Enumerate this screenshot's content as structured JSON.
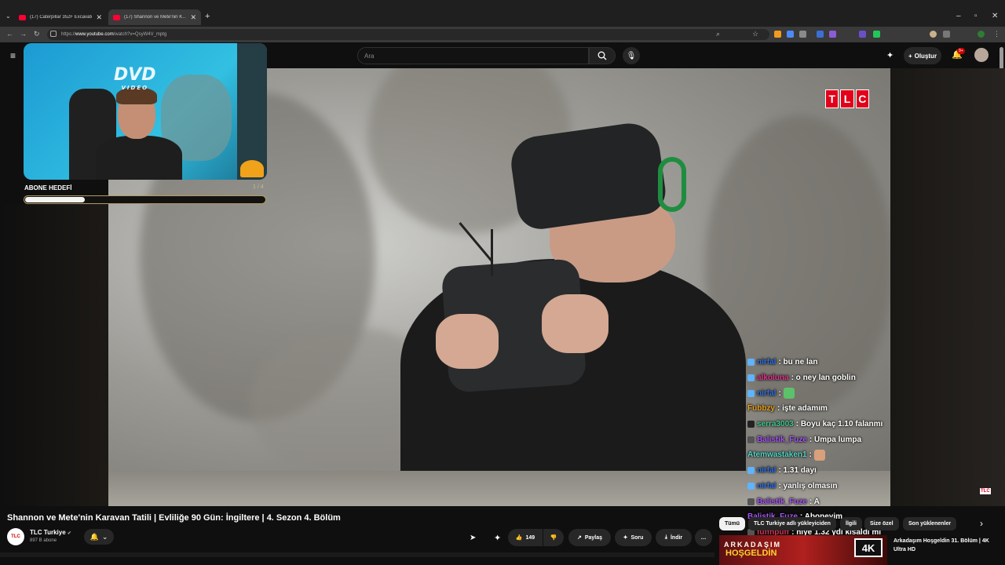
{
  "browser": {
    "tabs": [
      {
        "label": "(17) Caterpillar 352F Excavator …",
        "close": "✕"
      },
      {
        "label": "(17) Shannon ve Mete'nin K…",
        "close": "✕"
      }
    ],
    "new_tab": "+",
    "url_prefix": "https://",
    "url_host": "www.youtube.com",
    "url_path": "/watch?v=QsyW4V_mptg"
  },
  "youtube": {
    "search_placeholder": "Ara",
    "create_label": "Oluştur",
    "notif_count": "9+"
  },
  "overlay": {
    "goal_label": "ABONE HEDEFİ",
    "goal_count": "1 / 4",
    "goal_progress": 0.25,
    "dvd_text": "DVD",
    "dvd_sub": "VIDEO"
  },
  "tlc_logo": [
    "T",
    "L",
    "C"
  ],
  "chat": [
    {
      "user": "nirfal",
      "msg": ": bu ne lan",
      "color": "#2f6fe0"
    },
    {
      "user": "alkoluna",
      "msg": ": o ney lan goblin",
      "color": "#e0348c"
    },
    {
      "user": "nirfal",
      "msg": ":",
      "color": "#2f6fe0"
    },
    {
      "user": "Fubbzy",
      "msg": ": işte adamım",
      "color": "#e8a21c"
    },
    {
      "user": "serra3003",
      "msg": ": Boyu kaç 1.10 falanmı",
      "color": "#42c78e"
    },
    {
      "user": "Balistik_Fuze",
      "msg": ": Umpa lumpa",
      "color": "#a357f0"
    },
    {
      "user": "Atemwastaken1",
      "msg": ":",
      "color": "#4fd6c6"
    },
    {
      "user": "nirfal",
      "msg": ": 1.31 dayı",
      "color": "#2f6fe0"
    },
    {
      "user": "nirfal",
      "msg": ": yanlış olmasın",
      "color": "#2f6fe0"
    },
    {
      "user": "Balistik_Fuze",
      "msg": ": A",
      "color": "#a357f0"
    },
    {
      "user": "Balistik_Fuze",
      "msg": ": Aboneyim",
      "color": "#a357f0"
    },
    {
      "user": "fuffnpuff",
      "msg": ": niye 1.32 ydi kısaldı mı",
      "color": "#d9365b"
    }
  ],
  "video": {
    "title": "Shannon ve Mete'nin Karavan Tatili | Evliliğe 90 Gün: İngiltere | 4. Sezon 4. Bölüm",
    "channel": "TLC Turkiye",
    "channel_avatar": "TLC",
    "subscribers": "897 B abone",
    "likes": "149",
    "share": "Paylaş",
    "ask": "Soru",
    "download": "İndir",
    "more": "…"
  },
  "recommendations": {
    "chips": [
      "Tümü",
      "TLC Turkiye adlı yükleyiciden",
      "İlgili",
      "Size özel",
      "Son yüklenenler"
    ],
    "thumb_line1": "ARKADAŞIM",
    "thumb_line2": "HOŞGELDİN",
    "thumb_badge": "4K",
    "first_title": "Arkadaşım Hoşgeldin 31. Bölüm | 4K Ultra HD"
  }
}
